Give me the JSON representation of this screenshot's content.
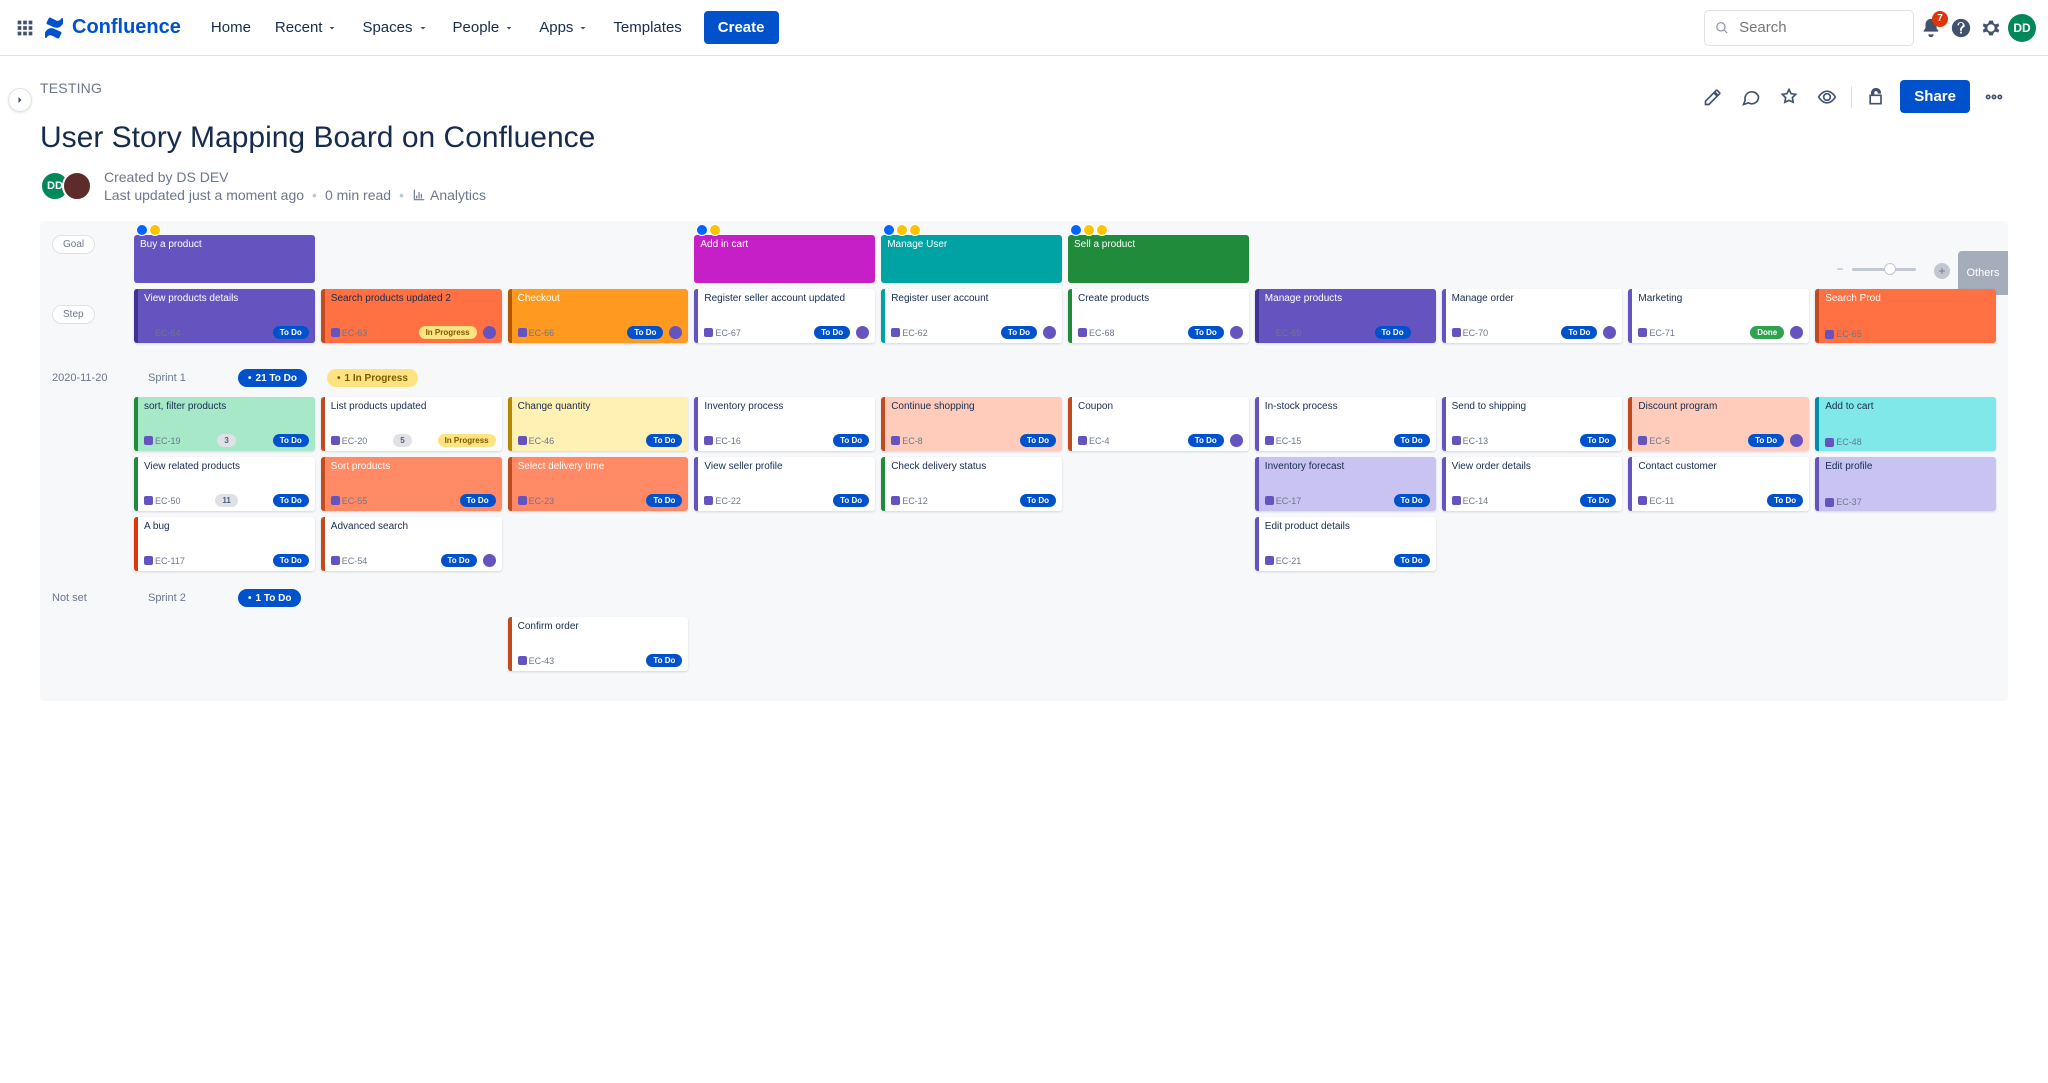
{
  "header": {
    "brand": "Confluence",
    "nav": [
      "Home",
      "Recent",
      "Spaces",
      "People",
      "Apps",
      "Templates"
    ],
    "create": "Create",
    "search_placeholder": "Search",
    "notif_count": "7",
    "avatar": "DD"
  },
  "page": {
    "breadcrumb": "TESTING",
    "title": "User Story Mapping Board on Confluence",
    "created_by": "Created by DS DEV",
    "updated": "Last updated just a moment ago",
    "readtime": "0 min read",
    "analytics": "Analytics",
    "share": "Share",
    "avatar": "DD"
  },
  "board": {
    "lane_goal": "Goal",
    "lane_step": "Step",
    "others": "Others",
    "goals": [
      {
        "title": "Buy a product",
        "col": 1
      },
      {
        "title": "Add in cart",
        "col": 4
      },
      {
        "title": "Manage User",
        "col": 5
      },
      {
        "title": "Sell a product",
        "col": 6
      }
    ],
    "steps": [
      {
        "title": "View products details",
        "key": "EC-64",
        "pill": "To Do",
        "col": 1,
        "style": "bl-purple filled"
      },
      {
        "title": "Search products updated 2",
        "key": "EC-63",
        "pill": "In Progress",
        "col": 2,
        "style": "bl-orange2",
        "av": true
      },
      {
        "title": "Checkout",
        "key": "EC-66",
        "pill": "To Do",
        "col": 3,
        "style": "bl-orange filled",
        "av": true
      },
      {
        "title": "Register seller account updated",
        "key": "EC-67",
        "pill": "To Do",
        "col": 4,
        "style": "bl-purple-l",
        "av": true
      },
      {
        "title": "Register user account",
        "key": "EC-62",
        "pill": "To Do",
        "col": 5,
        "style": "bl-teal",
        "av": true
      },
      {
        "title": "Create products",
        "key": "EC-68",
        "pill": "To Do",
        "col": 6,
        "style": "bl-green",
        "av": true
      },
      {
        "title": "Manage products",
        "key": "EC-69",
        "pill": "To Do",
        "col": 7,
        "style": "bl-purple filled",
        "av": true
      },
      {
        "title": "Manage order",
        "key": "EC-70",
        "pill": "To Do",
        "col": 8,
        "style": "bl-purple-l",
        "av": true
      },
      {
        "title": "Marketing",
        "key": "EC-71",
        "pill": "Done",
        "col": 9,
        "style": "bl-purple-l",
        "av": true
      },
      {
        "title": "Search Prod",
        "key": "EC-65",
        "pill": "",
        "col": 10,
        "style": "bl-orange2 filled"
      }
    ],
    "sprint1": {
      "date": "2020-11-20",
      "name": "Sprint 1",
      "chips": [
        "21 To Do",
        "1 In Progress"
      ],
      "rows": [
        [
          {
            "title": "sort, filter products",
            "key": "EC-19",
            "pill": "To Do",
            "col": 1,
            "style": "s-mint",
            "extra": "3"
          },
          {
            "title": "List products updated",
            "key": "EC-20",
            "pill": "In Progress",
            "col": 2,
            "style": "s-white-o",
            "extra": "5"
          },
          {
            "title": "Change quantity",
            "key": "EC-46",
            "pill": "To Do",
            "col": 3,
            "style": "s-yel"
          },
          {
            "title": "Inventory process",
            "key": "EC-16",
            "pill": "To Do",
            "col": 4,
            "style": "s-white-p"
          },
          {
            "title": "Continue shopping",
            "key": "EC-8",
            "pill": "To Do",
            "col": 5,
            "style": "s-sal"
          },
          {
            "title": "Coupon",
            "key": "EC-4",
            "pill": "To Do",
            "col": 6,
            "style": "s-white-o",
            "av": true
          },
          {
            "title": "In-stock process",
            "key": "EC-15",
            "pill": "To Do",
            "col": 7,
            "style": "s-white-p"
          },
          {
            "title": "Send to shipping",
            "key": "EC-13",
            "pill": "To Do",
            "col": 8,
            "style": "s-white-p"
          },
          {
            "title": "Discount program",
            "key": "EC-5",
            "pill": "To Do",
            "col": 9,
            "style": "s-sal",
            "av": true
          },
          {
            "title": "Add to cart",
            "key": "EC-48",
            "pill": "",
            "col": 10,
            "style": "s-cyan"
          }
        ],
        [
          {
            "title": "View related products",
            "key": "EC-50",
            "pill": "To Do",
            "col": 1,
            "style": "s-white-g",
            "extra": "11"
          },
          {
            "title": "Sort products",
            "key": "EC-55",
            "pill": "To Do",
            "col": 2,
            "style": "s-orange"
          },
          {
            "title": "Select delivery time",
            "key": "EC-23",
            "pill": "To Do",
            "col": 3,
            "style": "s-orange"
          },
          {
            "title": "View seller profile",
            "key": "EC-22",
            "pill": "To Do",
            "col": 4,
            "style": "s-white-p"
          },
          {
            "title": "Check delivery status",
            "key": "EC-12",
            "pill": "To Do",
            "col": 5,
            "style": "s-white-g"
          },
          {
            "title": "Inventory forecast",
            "key": "EC-17",
            "pill": "To Do",
            "col": 7,
            "style": "s-lav"
          },
          {
            "title": "View order details",
            "key": "EC-14",
            "pill": "To Do",
            "col": 8,
            "style": "s-white-p"
          },
          {
            "title": "Contact customer",
            "key": "EC-11",
            "pill": "To Do",
            "col": 9,
            "style": "s-white-p"
          },
          {
            "title": "Edit profile",
            "key": "EC-37",
            "pill": "",
            "col": 10,
            "style": "s-lav"
          }
        ],
        [
          {
            "title": "A bug",
            "key": "EC-117",
            "pill": "To Do",
            "col": 1,
            "style": "s-white-red"
          },
          {
            "title": "Advanced search",
            "key": "EC-54",
            "pill": "To Do",
            "col": 2,
            "style": "s-white-o",
            "av": true
          },
          {
            "title": "Edit product details",
            "key": "EC-21",
            "pill": "To Do",
            "col": 7,
            "style": "s-white-p"
          }
        ]
      ]
    },
    "sprint2": {
      "date": "Not set",
      "name": "Sprint 2",
      "chips": [
        "1 To Do"
      ],
      "rows": [
        [
          {
            "title": "Confirm order",
            "key": "EC-43",
            "pill": "To Do",
            "col": 3,
            "style": "s-white-o"
          }
        ]
      ]
    }
  }
}
